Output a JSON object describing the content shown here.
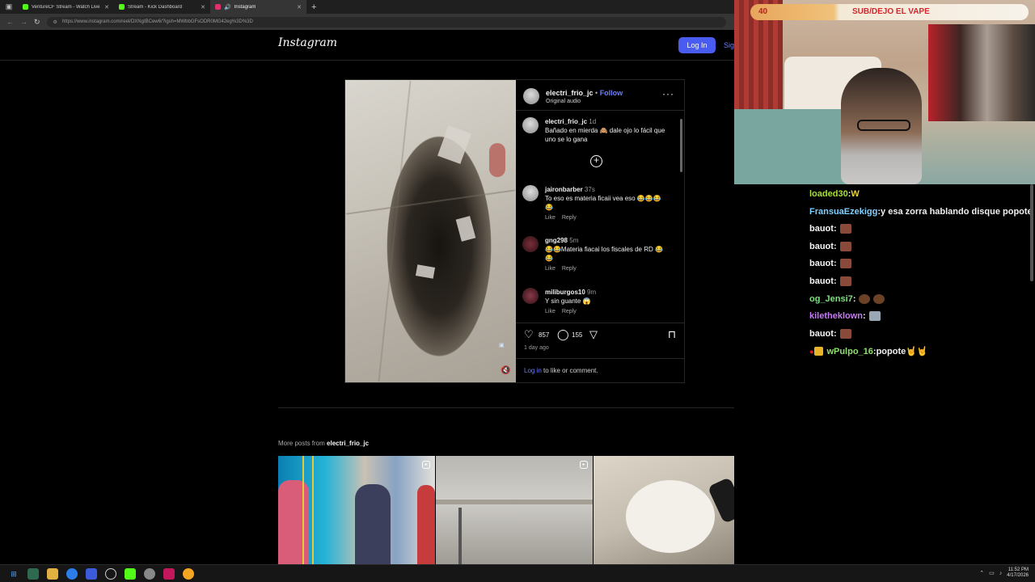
{
  "browser": {
    "tabs": [
      {
        "title": "VentureCF Stream - Watch Live o",
        "fav_color": "#53fc18",
        "active": false
      },
      {
        "title": "Stream - Kick Dashboard",
        "fav_color": "#53fc18",
        "active": false
      },
      {
        "title": "Instagram",
        "fav_color": "#e1306c",
        "active": true
      }
    ],
    "new_tab_label": "+",
    "url": "https://www.instagram.com/reel/DXNgIBCew6/?igsh=MWbbGFsODR0MG42eg%3D%3D"
  },
  "instagram": {
    "logo": "Instagram",
    "login_button": "Log In",
    "signup_link": "Sig",
    "post": {
      "author": "electri_frio_jc",
      "dot": " • ",
      "follow": "Follow",
      "audio": "Original audio",
      "more_icon": "···",
      "caption": {
        "user": "electri_frio_jc",
        "time": "1d",
        "text": "Bañado en mierda 🙈 dale ojo lo fácil que uno se lo gana"
      },
      "comments": [
        {
          "user": "jaironbarber",
          "time": "37s",
          "text": "To eso es materia ficaii vea eso 😂😂😂😂",
          "like": "Like",
          "reply": "Reply"
        },
        {
          "user": "gng298",
          "time": "5m",
          "text": "😂😂Materia fiacai los fiscales de RD 😂😂",
          "like": "Like",
          "reply": "Reply"
        },
        {
          "user": "miliburgos10",
          "time": "9m",
          "text": "Y sin guante 😱",
          "like": "Like",
          "reply": "Reply"
        }
      ],
      "likes": "857",
      "comment_count": "155",
      "posted": "1 day ago",
      "login_link": "Log in",
      "login_rest": " to like or comment."
    },
    "more_posts_prefix": "More posts from ",
    "more_posts_user": "electri_frio_jc"
  },
  "stream": {
    "counter": "40",
    "banner": "SUB/DEJO EL VAPE"
  },
  "chat": [
    {
      "user": "loaded30",
      "color": "#a6e22e",
      "sep": " : ",
      "msg": "W",
      "emote": "#e8d23a"
    },
    {
      "user": "FransuaEzekigg",
      "color": "#7fd0ff",
      "sep": " : ",
      "msg": "y esa zorra hablando disque popote",
      "emote": ""
    },
    {
      "user": "bauot",
      "color": "#f0f0f0",
      "sep": " : ",
      "msg": "",
      "emote": "#8a4a3a"
    },
    {
      "user": "bauot",
      "color": "#f0f0f0",
      "sep": " : ",
      "msg": "",
      "emote": "#8a4a3a"
    },
    {
      "user": "bauot",
      "color": "#f0f0f0",
      "sep": " : ",
      "msg": "",
      "emote": "#8a4a3a"
    },
    {
      "user": "bauot",
      "color": "#f0f0f0",
      "sep": " : ",
      "msg": "",
      "emote": "#8a4a3a"
    },
    {
      "user": "og_Jensi7",
      "color": "#7be27b",
      "sep": " : ",
      "msg": "",
      "emote": "#6b4226"
    },
    {
      "user": "kiletheklown",
      "color": "#c47cf2",
      "sep": " : ",
      "msg": "",
      "emote": "#9aa8b6"
    },
    {
      "user": "bauot",
      "color": "#f0f0f0",
      "sep": " : ",
      "msg": "",
      "emote": "#8a4a3a"
    },
    {
      "user": "wPulpo_16",
      "color": "#8ee26b",
      "sep": " : ",
      "msg": "popote🤘🤘",
      "emote": ""
    }
  ],
  "taskbar": {
    "time": "11:52 PM",
    "date": "4/17/2026"
  }
}
